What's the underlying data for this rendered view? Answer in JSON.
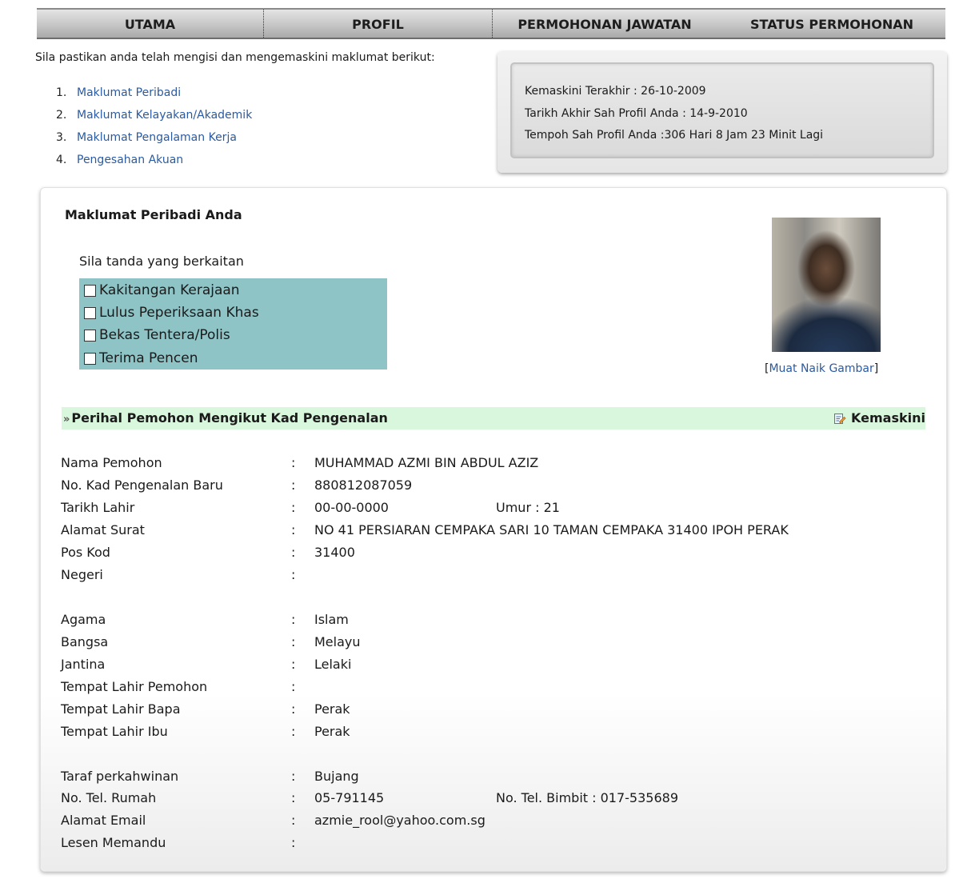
{
  "nav": {
    "items": [
      {
        "label": "UTAMA"
      },
      {
        "label": "PROFIL"
      },
      {
        "label": "PERMOHONAN JAWATAN"
      },
      {
        "label": "STATUS PERMOHONAN"
      }
    ],
    "active": "PROFIL"
  },
  "intro": {
    "text": "Sila pastikan anda telah mengisi dan mengemaskini maklumat berikut:",
    "steps": [
      {
        "num": "1.",
        "label": "Maklumat Peribadi"
      },
      {
        "num": "2.",
        "label": "Maklumat Kelayakan/Akademik"
      },
      {
        "num": "3.",
        "label": "Maklumat Pengalaman Kerja"
      },
      {
        "num": "4.",
        "label": "Pengesahan Akuan"
      }
    ]
  },
  "validity": {
    "last_update": "Kemaskini Terakhir : 26-10-2009",
    "valid_until": "Tarikh Akhir Sah Profil Anda : 14-9-2010",
    "remaining": "Tempoh Sah Profil Anda :306 Hari 8 Jam 23 Minit Lagi"
  },
  "profile": {
    "title": "Maklumat Peribadi Anda",
    "mark_prompt": "Sila tanda yang berkaitan",
    "checkboxes": [
      {
        "label": "Kakitangan Kerajaan",
        "checked": false
      },
      {
        "label": "Lulus Peperiksaan Khas",
        "checked": false
      },
      {
        "label": "Bekas Tentera/Polis",
        "checked": false
      },
      {
        "label": "Terima Pencen",
        "checked": false
      }
    ],
    "upload": {
      "open": "[",
      "label": "Muat Naik Gambar",
      "close": "]"
    }
  },
  "section": {
    "marker": "»",
    "title": "Perihal Pemohon Mengikut Kad Pengenalan",
    "edit_label": "Kemaskini",
    "band_color": "#d9f7dd"
  },
  "details": [
    {
      "label": "Nama Pemohon",
      "value": "MUHAMMAD AZMI BIN ABDUL AZIZ",
      "extra": ""
    },
    {
      "label": "No. Kad Pengenalan Baru",
      "value": "880812087059",
      "extra": ""
    },
    {
      "label": "Tarikh Lahir",
      "value": "00-00-0000",
      "extra": "Umur : 21"
    },
    {
      "label": "Alamat Surat",
      "value": "NO 41 PERSIARAN CEMPAKA SARI 10 TAMAN CEMPAKA 31400 IPOH PERAK",
      "extra": ""
    },
    {
      "label": "Pos Kod",
      "value": "31400",
      "extra": ""
    },
    {
      "label": "Negeri",
      "value": "",
      "extra": ""
    },
    {
      "label": "Agama",
      "value": "Islam",
      "extra": ""
    },
    {
      "label": "Bangsa",
      "value": "Melayu",
      "extra": ""
    },
    {
      "label": "Jantina",
      "value": "Lelaki",
      "extra": ""
    },
    {
      "label": "Tempat Lahir Pemohon",
      "value": "",
      "extra": ""
    },
    {
      "label": "Tempat Lahir Bapa",
      "value": "Perak",
      "extra": ""
    },
    {
      "label": "Tempat Lahir Ibu",
      "value": "Perak",
      "extra": ""
    },
    {
      "label": "Taraf perkahwinan",
      "value": "Bujang",
      "extra": ""
    },
    {
      "label": "No. Tel. Rumah",
      "value": "05-791145",
      "extra": "No. Tel. Bimbit : 017-535689"
    },
    {
      "label": "Alamat Email",
      "value": "azmie_rool@yahoo.com.sg",
      "extra": ""
    },
    {
      "label": "Lesen Memandu",
      "value": "",
      "extra": ""
    }
  ],
  "colon": ":"
}
